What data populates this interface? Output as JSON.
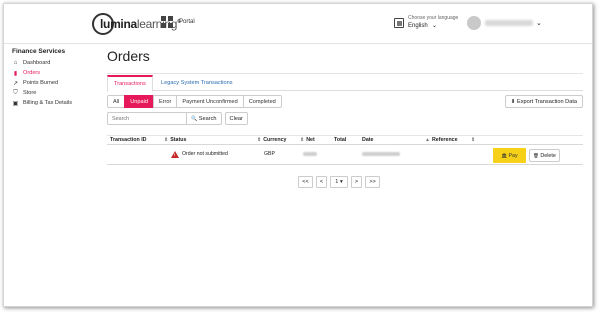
{
  "header": {
    "logo_text_bold": "lumina",
    "logo_text_light": "learning",
    "logo_trademark": "®",
    "apps_icon": "grid-icon",
    "portal_label": "Portal",
    "language_prompt": "Choose your language",
    "language_value": "English",
    "language_caret": "⌄",
    "user_caret": "⌄"
  },
  "sidebar": {
    "title": "Finance Services",
    "items": [
      {
        "label": "Dashboard",
        "icon": "⌂",
        "icon_name": "home-icon"
      },
      {
        "label": "Orders",
        "icon": "▮",
        "icon_name": "orders-icon"
      },
      {
        "label": "Points Burned",
        "icon": "↗",
        "icon_name": "points-icon"
      },
      {
        "label": "Store",
        "icon": "⛉",
        "icon_name": "store-icon"
      },
      {
        "label": "Billing & Tax Details",
        "icon": "▣",
        "icon_name": "billing-icon"
      }
    ],
    "active_index": 1
  },
  "main": {
    "title": "Orders",
    "tabs": [
      {
        "label": "Transactions",
        "active": true
      },
      {
        "label": "Legacy System Transactions",
        "active": false
      }
    ],
    "filters": [
      {
        "label": "All",
        "active": false
      },
      {
        "label": "Unpaid",
        "active": true
      },
      {
        "label": "Error",
        "active": false
      },
      {
        "label": "Payment Unconfirmed",
        "active": false
      },
      {
        "label": "Completed",
        "active": false
      }
    ],
    "export_label": "Export Transaction Data",
    "export_icon": "⬇",
    "search_placeholder": "Search",
    "search_button": "Search",
    "search_icon": "🔍",
    "clear_button": "Clear"
  },
  "table": {
    "sort_glyph": "⇕",
    "reference_sort_glyph": "▲",
    "columns": [
      "Transaction ID",
      "Status",
      "Currency",
      "Net",
      "Total",
      "Date",
      "Reference"
    ],
    "rows": [
      {
        "status": "Order not submitted",
        "currency": "GBP",
        "pay_label": "Pay",
        "pay_icon": "🏛",
        "delete_label": "Delete",
        "delete_icon": "🗑"
      }
    ]
  },
  "pager": {
    "first": "<<",
    "prev": "<",
    "page": "1",
    "page_caret": "▾",
    "next": ">",
    "last": ">>"
  },
  "colors": {
    "accent": "#e6195a",
    "pay": "#f7d117",
    "link": "#2b6cb0",
    "error": "#c62828"
  }
}
